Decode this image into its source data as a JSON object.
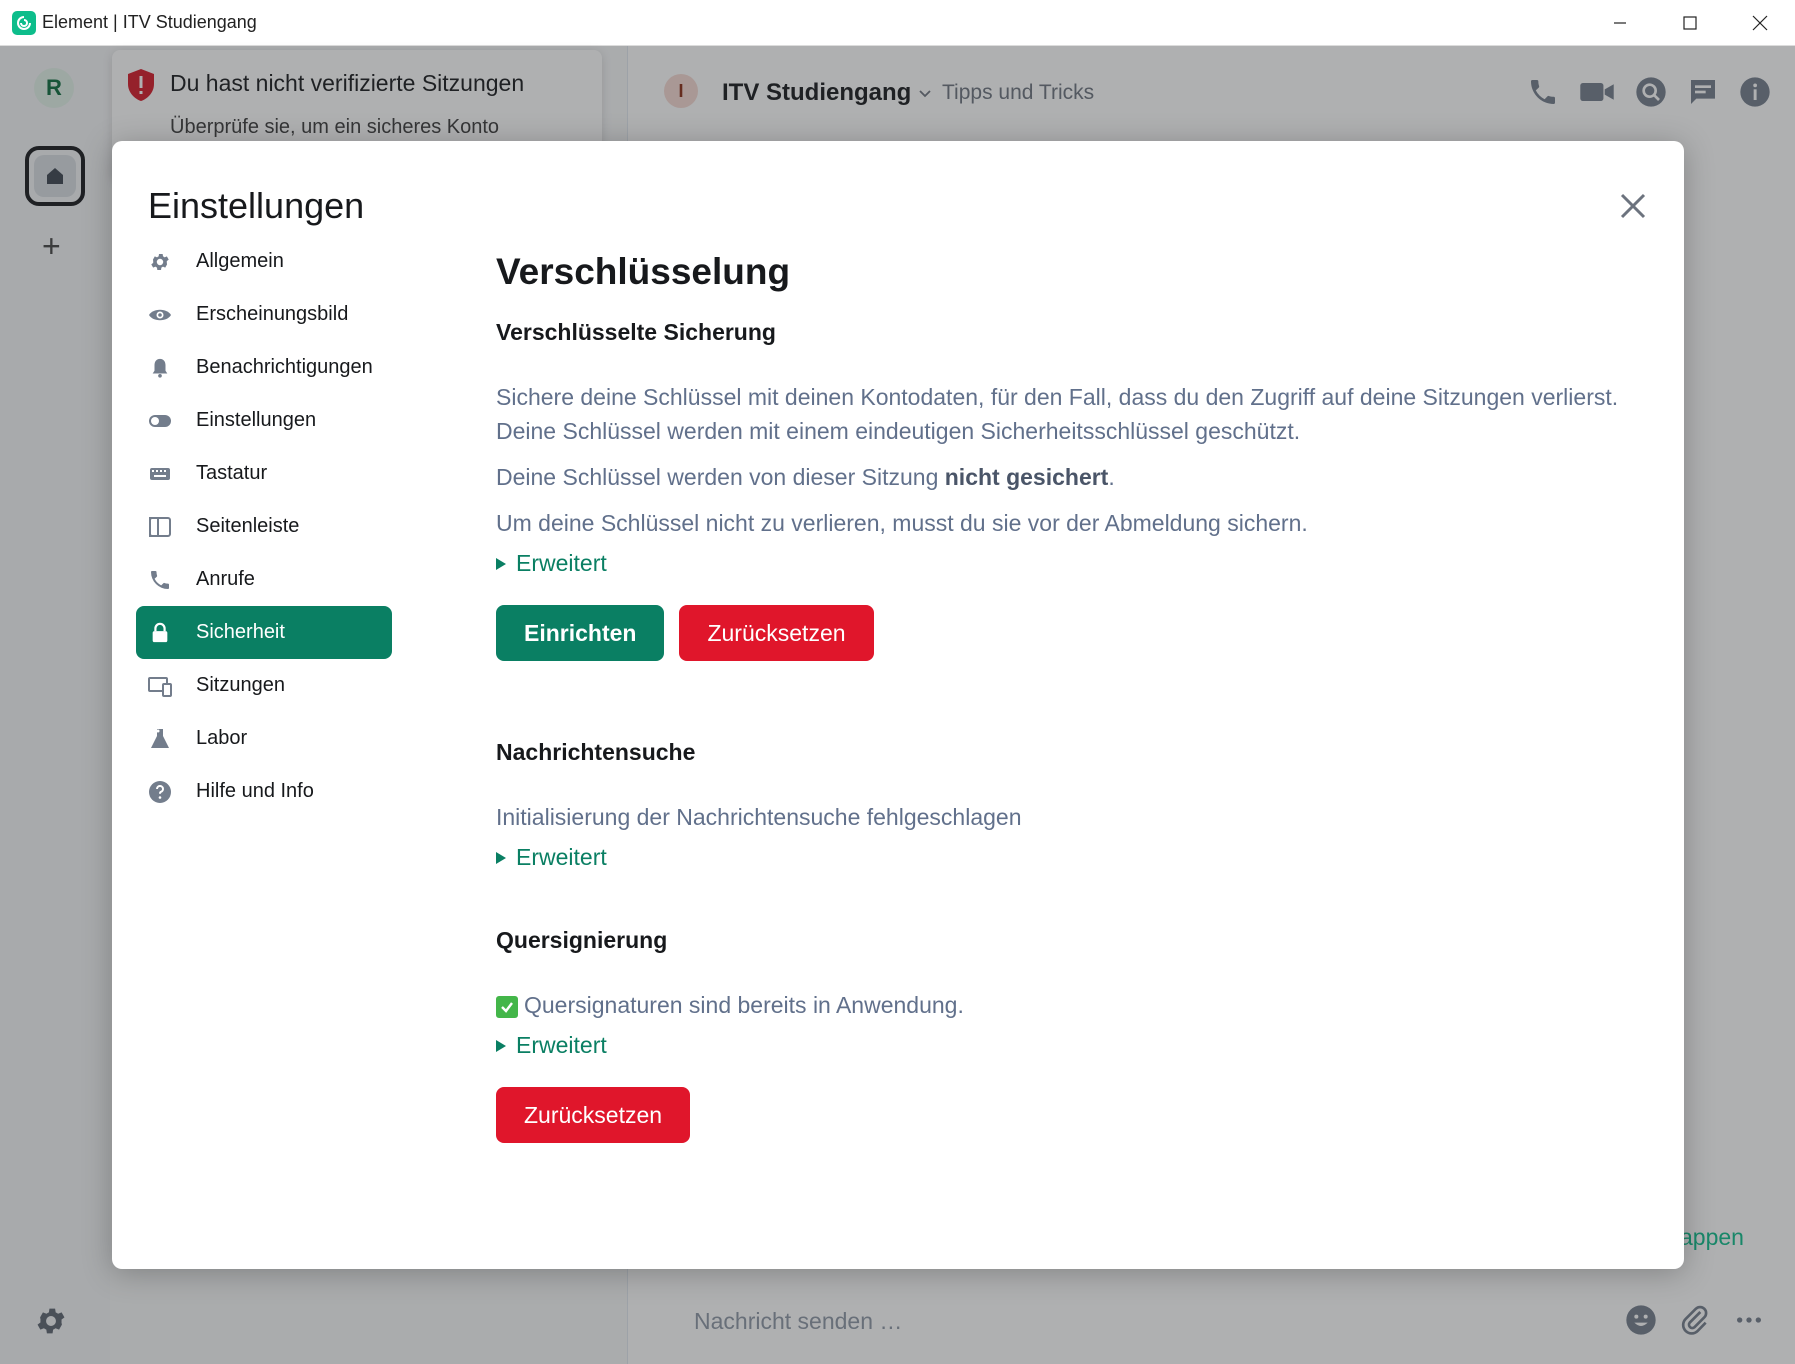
{
  "window": {
    "title": "Element | ITV Studiengang"
  },
  "spaces": {
    "user_initial": "R",
    "add_label": "+"
  },
  "toast": {
    "title": "Du hast nicht verifizierte Sitzungen",
    "body": "Überprüfe sie, um ein sicheres Konto"
  },
  "room": {
    "avatar_letter": "I",
    "name": "ITV Studiengang",
    "topic": "Tipps und Tricks",
    "composer_placeholder": "Nachricht senden …",
    "peek_text": "appen"
  },
  "dialog": {
    "title": "Einstellungen",
    "tabs": [
      {
        "label": "Allgemein",
        "icon": "gear-icon"
      },
      {
        "label": "Erscheinungsbild",
        "icon": "eye-icon"
      },
      {
        "label": "Benachrichtigungen",
        "icon": "bell-icon"
      },
      {
        "label": "Einstellungen",
        "icon": "toggle-icon"
      },
      {
        "label": "Tastatur",
        "icon": "keyboard-icon"
      },
      {
        "label": "Seitenleiste",
        "icon": "sidebar-icon"
      },
      {
        "label": "Anrufe",
        "icon": "phone-icon"
      },
      {
        "label": "Sicherheit",
        "icon": "lock-icon"
      },
      {
        "label": "Sitzungen",
        "icon": "devices-icon"
      },
      {
        "label": "Labor",
        "icon": "flask-icon"
      },
      {
        "label": "Hilfe und Info",
        "icon": "help-icon"
      }
    ],
    "active_tab": "Sicherheit"
  },
  "security": {
    "heading": "Verschlüsselung",
    "backup": {
      "title": "Verschlüsselte Sicherung",
      "desc": "Sichere deine Schlüssel mit deinen Kontodaten, für den Fall, dass du den Zugriff auf deine Sitzungen verlierst. Deine Schlüssel werden mit einem eindeutigen Sicherheitsschlüssel geschützt.",
      "status_prefix": "Deine Schlüssel werden von dieser Sitzung ",
      "status_bold": "nicht gesichert",
      "status_suffix": ".",
      "hint": "Um deine Schlüssel nicht zu verlieren, musst du sie vor der Abmeldung sichern.",
      "advanced": "Erweitert",
      "setup_button": "Einrichten",
      "reset_button": "Zurücksetzen"
    },
    "search": {
      "title": "Nachrichtensuche",
      "desc": "Initialisierung der Nachrichtensuche fehlgeschlagen",
      "advanced": "Erweitert"
    },
    "cross_signing": {
      "title": "Quersignierung",
      "status": "Quersignaturen sind bereits in Anwendung.",
      "advanced": "Erweitert",
      "reset_button": "Zurücksetzen"
    }
  },
  "colors": {
    "accent": "#0a7f63",
    "danger": "#e0162b",
    "brand": "#0dbd8b"
  }
}
